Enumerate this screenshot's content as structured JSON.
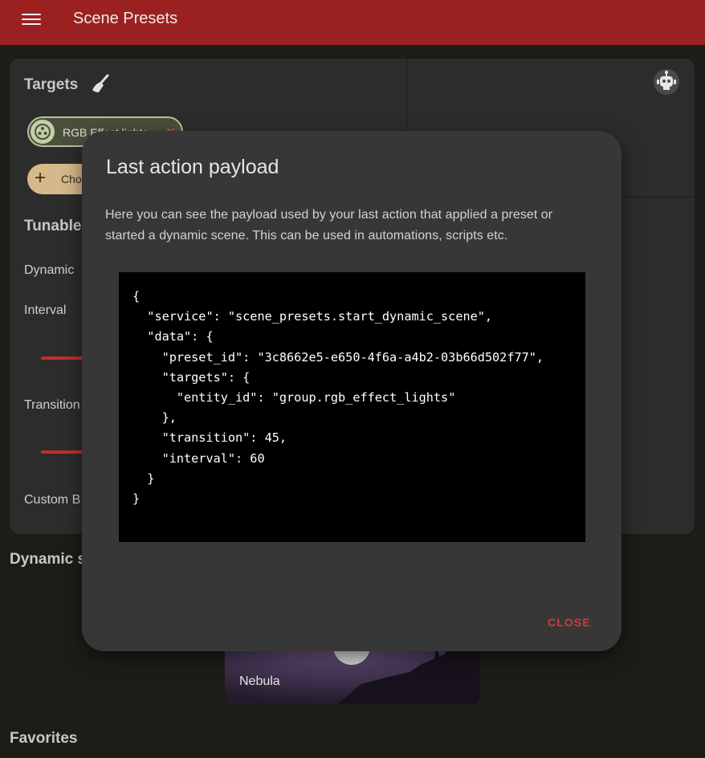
{
  "topbar": {
    "title": "Scene Presets",
    "accent": "#9b2121"
  },
  "targets": {
    "title": "Targets",
    "chip_label": "RGB Effect lights",
    "choose_label": "Choose"
  },
  "tunable": {
    "title": "Tunable",
    "dynamic_label": "Dynamic",
    "interval_label": "Interval",
    "transition_label": "Transition",
    "custom_label": "Custom B"
  },
  "sections": {
    "dynamic_title": "Dynamic s",
    "favorites_title": "Favorites"
  },
  "tile": {
    "label": "Nebula"
  },
  "dialog": {
    "title": "Last action payload",
    "description": "Here you can see the payload used by your last action that applied a preset or started a dynamic scene. This can be used in automations, scripts etc.",
    "payload": "{\n  \"service\": \"scene_presets.start_dynamic_scene\",\n  \"data\": {\n    \"preset_id\": \"3c8662e5-e650-4f6a-a4b2-03b66d502f77\",\n    \"targets\": {\n      \"entity_id\": \"group.rgb_effect_lights\"\n    },\n    \"transition\": 45,\n    \"interval\": 60\n  }\n}",
    "close_label": "CLOSE"
  },
  "icons": {
    "menu": "menu-icon",
    "broom": "broom-icon",
    "robot": "robot-icon",
    "target_avatar": "group-icon",
    "chip_remove": "close-icon",
    "add": "plus-icon"
  }
}
